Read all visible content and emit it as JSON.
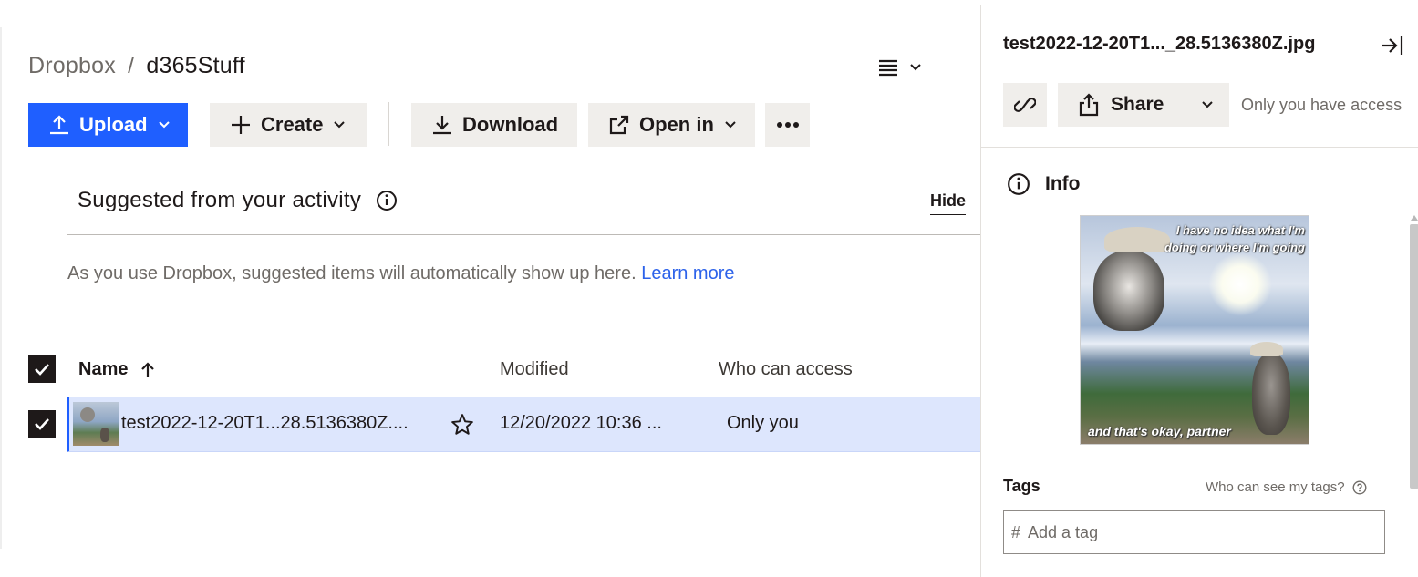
{
  "breadcrumb": {
    "root": "Dropbox",
    "separator": "/",
    "current": "d365Stuff"
  },
  "toolbar": {
    "upload_label": "Upload",
    "create_label": "Create",
    "download_label": "Download",
    "open_in_label": "Open in"
  },
  "suggested": {
    "title": "Suggested from your activity",
    "hide_label": "Hide",
    "text": "As you use Dropbox, suggested items will automatically show up here.",
    "learn_more": "Learn more"
  },
  "table": {
    "columns": {
      "name": "Name",
      "modified": "Modified",
      "access": "Who can access"
    },
    "rows": [
      {
        "name": "test2022-12-20T1...28.5136380Z....",
        "modified": "12/20/2022 10:36 ...",
        "access": "Only you",
        "starred": false,
        "selected": true
      }
    ]
  },
  "panel": {
    "file_title": "test2022-12-20T1..._28.5136380Z.jpg",
    "share_label": "Share",
    "access_text": "Only you have access",
    "info_label": "Info",
    "preview_caption_top": "I have no idea what I'm doing or where I'm going",
    "preview_caption_bottom": "and that's okay, partner",
    "tags_label": "Tags",
    "tags_question": "Who can see my tags?",
    "tag_prefix": "#",
    "tag_placeholder": "Add a tag"
  },
  "colors": {
    "accent": "#1f5fff",
    "row_selected": "#dde6fd",
    "link": "#2c62ea",
    "button_bg": "#f0eeeb"
  },
  "icons": [
    "upload-icon",
    "plus-icon",
    "download-icon",
    "open-external-icon",
    "more-icon",
    "list-view-icon",
    "info-icon",
    "sort-up-icon",
    "star-icon",
    "link-icon",
    "share-icon",
    "collapse-panel-icon",
    "help-icon",
    "check-icon",
    "chevron-down-icon"
  ]
}
